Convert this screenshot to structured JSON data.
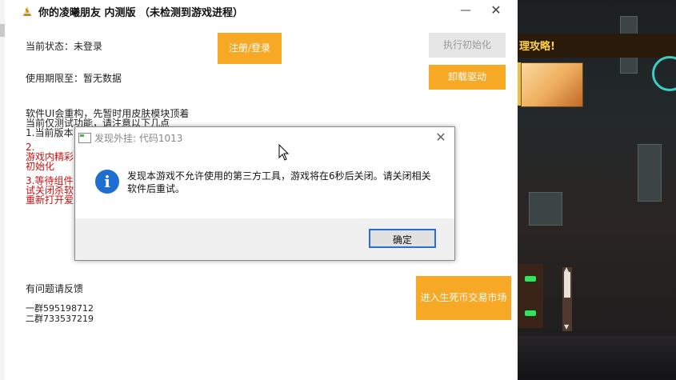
{
  "app": {
    "title": "你的凌曦朋友 内测版 （未检测到游戏进程）",
    "window_controls": {
      "minimize": "—",
      "close": "✕"
    },
    "status_text": "当前状态：未登录",
    "expiry_text": "使用期限至：暂无数据",
    "login_button": "注册/登录",
    "init_button": "执行初始化",
    "uninstall_button": "卸载驱动",
    "notice_lines": [
      "软件UI会重构，先暂时用皮肤模块顶着",
      "当前仅测试功能，请注意以下几点",
      "1.当前版本",
      "2.",
      "游戏内精彩",
      "初始化",
      "3.等待组件",
      "试关闭杀软",
      "重新打开爱"
    ],
    "feedback_text": "有问题请反馈",
    "group1": "一群595198712",
    "group2": "二群733537219",
    "market_button": "进入生死币交易市场"
  },
  "game": {
    "banner_text": "理攻略!"
  },
  "dialog": {
    "title": "发现外挂: 代码1013",
    "close": "✕",
    "info_icon_glyph": "i",
    "message": "发现本游戏不允许使用的第三方工具，游戏将在6秒后关闭。请关闭相关软件后重试。",
    "ok_button": "确定"
  },
  "colors": {
    "accent_orange": "#f7a824",
    "disabled_gray": "#e6e6e6",
    "notice_red": "#cc1111",
    "info_blue": "#1f6fd0",
    "focus_blue": "#2b6fd6"
  }
}
